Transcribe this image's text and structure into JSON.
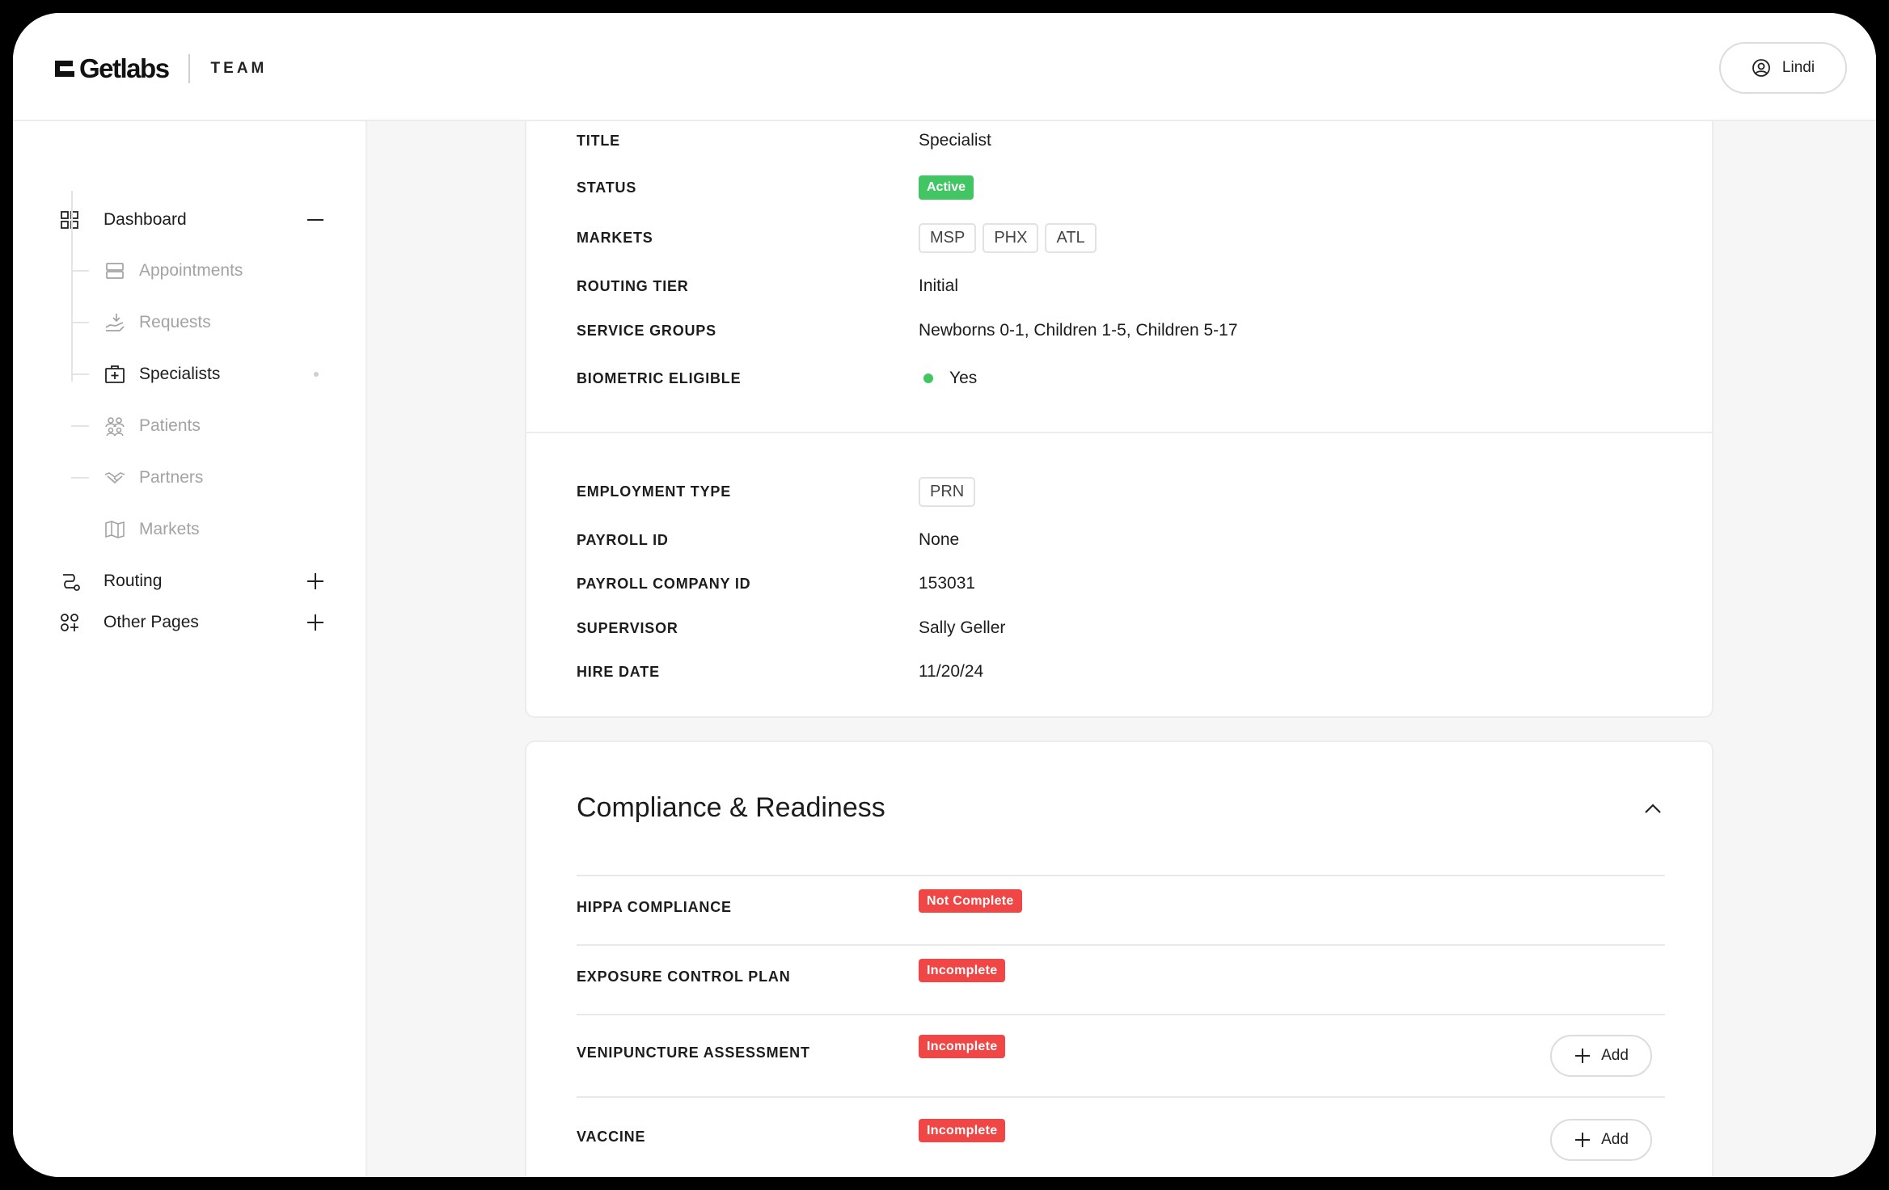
{
  "header": {
    "logo": "Getlabs",
    "team": "TEAM",
    "user": "Lindi"
  },
  "sidebar": {
    "dashboard": "Dashboard",
    "items": [
      {
        "label": "Appointments",
        "icon": "appointments-icon"
      },
      {
        "label": "Requests",
        "icon": "requests-icon"
      },
      {
        "label": "Specialists",
        "icon": "specialists-icon"
      },
      {
        "label": "Patients",
        "icon": "patients-icon"
      },
      {
        "label": "Partners",
        "icon": "partners-icon"
      },
      {
        "label": "Markets",
        "icon": "markets-icon"
      }
    ],
    "routing": "Routing",
    "other_pages": "Other Pages"
  },
  "profile": {
    "title_label": "TITLE",
    "title_value": "Specialist",
    "status_label": "STATUS",
    "status_value": "Active",
    "markets_label": "MARKETS",
    "markets": [
      "MSP",
      "PHX",
      "ATL"
    ],
    "routing_tier_label": "ROUTING TIER",
    "routing_tier_value": "Initial",
    "service_groups_label": "SERVICE GROUPS",
    "service_groups_value": "Newborns 0-1, Children 1-5, Children 5-17",
    "biometric_label": "BIOMETRIC ELIGIBLE",
    "biometric_value": "Yes"
  },
  "employment": {
    "type_label": "EMPLOYMENT TYPE",
    "type_value": "PRN",
    "payroll_label": "PAYROLL ID",
    "payroll_value": "None",
    "company_label": "PAYROLL COMPANY ID",
    "company_value": "153031",
    "supervisor_label": "SUPERVISOR",
    "supervisor_value": "Sally Geller",
    "hire_label": "HIRE DATE",
    "hire_value": "11/20/24"
  },
  "compliance": {
    "title": "Compliance & Readiness",
    "rows": [
      {
        "label": "HIPPA COMPLIANCE",
        "status": "Not Complete"
      },
      {
        "label": "EXPOSURE CONTROL PLAN",
        "status": "Incomplete"
      },
      {
        "label": "VENIPUNCTURE ASSESSMENT",
        "status": "Incomplete",
        "action": "Add"
      },
      {
        "label": "VACCINE",
        "status": "Incomplete",
        "action": "Add"
      }
    ]
  },
  "colors": {
    "active_green": "#42c664",
    "incomplete_red": "#f04646"
  }
}
